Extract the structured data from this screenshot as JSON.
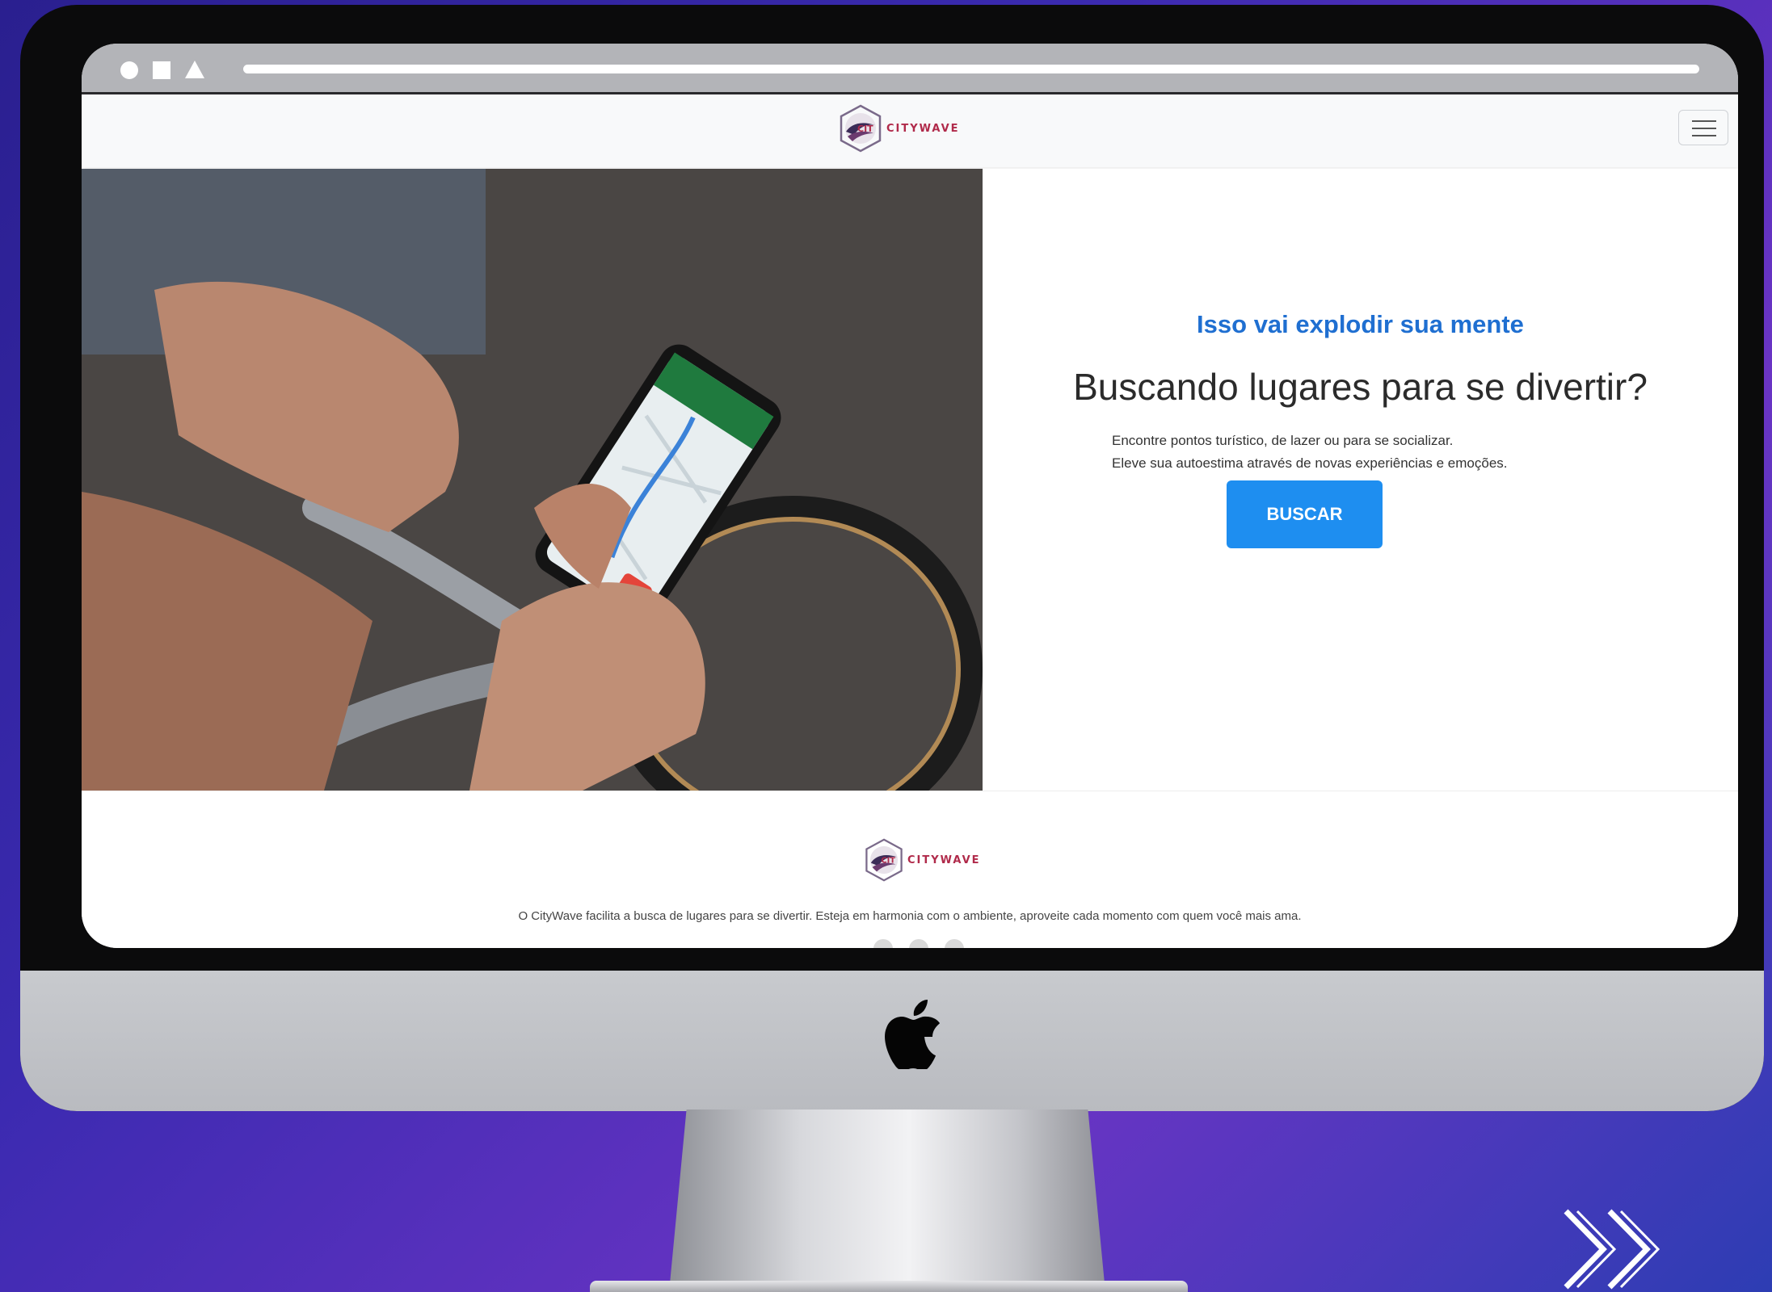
{
  "site": {
    "brand_name": "CITYWAVE",
    "menu_icon": "hamburger-menu-icon"
  },
  "hero": {
    "eyebrow": "Isso vai explodir sua mente",
    "headline": "Buscando lugares para se divertir?",
    "description_line1": "Encontre pontos turístico, de lazer ou para se socializar.",
    "description_line2": "Eleve sua autoestima através de novas experiências e emoções.",
    "cta_label": "BUSCAR",
    "image_alt": "Pessoa usando mapa no celular sobre uma bicicleta"
  },
  "footer": {
    "brand_name": "CITYWAVE",
    "text": "O CityWave facilita a busca de lugares para se divertir. Esteja em harmonia com o ambiente, aproveite cada momento com quem você mais ama."
  },
  "device": {
    "logo_icon": "apple-logo-icon"
  },
  "colors": {
    "accent": "#1e8ef0",
    "eyebrow": "#1f6fd1",
    "brand": "#b02a4a",
    "background_start": "#2a1f8f",
    "background_end": "#6a34c4"
  }
}
